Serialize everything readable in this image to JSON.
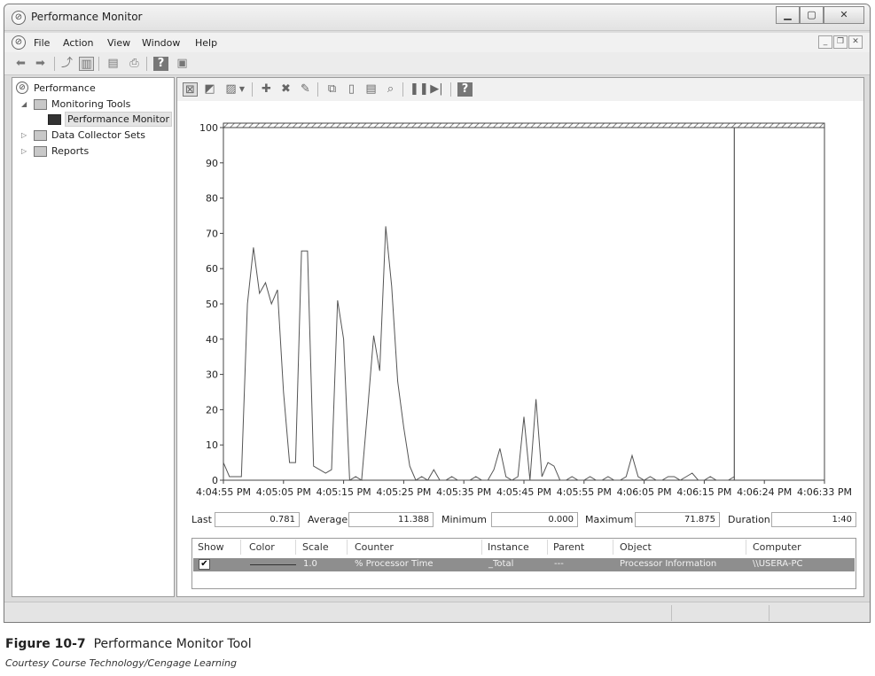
{
  "window": {
    "title": "Performance Monitor",
    "caption_buttons": [
      "minimize-icon",
      "maximize-icon",
      "close-icon"
    ]
  },
  "menu": {
    "items": [
      "File",
      "Action",
      "View",
      "Window",
      "Help"
    ]
  },
  "toolbar": {
    "icons": [
      "back-arrow-icon",
      "forward-arrow-icon",
      "up-folder-icon",
      "show-hide-tree-icon",
      "properties-icon",
      "print-icon",
      "help-icon",
      "console-icon"
    ]
  },
  "tree": {
    "root": "Performance",
    "items": [
      {
        "label": "Monitoring Tools",
        "expanded": true
      },
      {
        "label": "Performance Monitor",
        "selected": true
      },
      {
        "label": "Data Collector Sets",
        "expanded": false
      },
      {
        "label": "Reports",
        "expanded": false
      }
    ]
  },
  "perf_toolbar": {
    "icons": [
      "view-graph-icon",
      "freeze-display-icon",
      "change-graph-type-icon",
      "add-counter-icon",
      "delete-counter-icon",
      "highlight-icon",
      "copy-properties-icon",
      "paste-counter-list-icon",
      "properties-icon",
      "zoom-icon",
      "pause-icon",
      "next-frame-icon",
      "help-icon"
    ]
  },
  "chart_data": {
    "type": "line",
    "title": "",
    "xlabel": "",
    "ylabel": "",
    "ylim": [
      0,
      100
    ],
    "yticks": [
      0,
      10,
      20,
      30,
      40,
      50,
      60,
      70,
      80,
      90,
      100
    ],
    "xticks": [
      "4:04:55 PM",
      "4:05:05 PM",
      "4:05:15 PM",
      "4:05:25 PM",
      "4:05:35 PM",
      "4:05:45 PM",
      "4:05:55 PM",
      "4:06:05 PM",
      "4:06:15 PM",
      "4:06:24 PM",
      "4:06:33 PM"
    ],
    "xlim": [
      0,
      100
    ],
    "grid": false,
    "current_time_marker": 85,
    "series": [
      {
        "color": "#555555",
        "x": [
          0,
          1,
          2,
          3,
          4,
          5,
          6,
          7,
          8,
          9,
          10,
          11,
          12,
          13,
          14,
          15,
          16,
          17,
          18,
          19,
          20,
          21,
          22,
          23,
          24,
          25,
          26,
          27,
          28,
          29,
          30,
          31,
          32,
          33,
          34,
          35,
          36,
          37,
          38,
          39,
          40,
          41,
          42,
          43,
          44,
          45,
          46,
          47,
          48,
          49,
          50,
          51,
          52,
          53,
          54,
          55,
          56,
          57,
          58,
          59,
          60,
          61,
          62,
          63,
          64,
          65,
          66,
          67,
          68,
          69,
          70,
          71,
          72,
          73,
          74,
          75,
          76,
          77,
          78,
          79,
          80,
          81,
          82,
          83,
          84,
          85
        ],
        "values": [
          5,
          1,
          1,
          1,
          50,
          66,
          53,
          56,
          50,
          54,
          25,
          5,
          5,
          65,
          65,
          4,
          3,
          2,
          3,
          51,
          40,
          0,
          1,
          0,
          20,
          41,
          31,
          72,
          55,
          28,
          15,
          4,
          0,
          1,
          0,
          3,
          0,
          0,
          1,
          0,
          0,
          0,
          1,
          0,
          0,
          3,
          9,
          1,
          0,
          1,
          18,
          0,
          23,
          1,
          5,
          4,
          0,
          0,
          1,
          0,
          0,
          1,
          0,
          0,
          1,
          0,
          0,
          1,
          7,
          1,
          0,
          1,
          0,
          0,
          1,
          1,
          0,
          1,
          2,
          0,
          0,
          1,
          0,
          0,
          0,
          1
        ]
      }
    ]
  },
  "stats": {
    "last_label": "Last",
    "last_value": "0.781",
    "average_label": "Average",
    "average_value": "11.388",
    "minimum_label": "Minimum",
    "minimum_value": "0.000",
    "maximum_label": "Maximum",
    "maximum_value": "71.875",
    "duration_label": "Duration",
    "duration_value": "1:40"
  },
  "counter_table": {
    "headers": [
      "Show",
      "Color",
      "Scale",
      "Counter",
      "Instance",
      "Parent",
      "Object",
      "Computer"
    ],
    "rows": [
      {
        "show": true,
        "color": "#333333",
        "scale": "1.0",
        "counter": "% Processor Time",
        "instance": "_Total",
        "parent": "---",
        "object": "Processor Information",
        "computer": "\\\\USERA-PC"
      }
    ]
  },
  "figure": {
    "label": "Figure 10-7",
    "title": "Performance Monitor Tool",
    "credit": "Courtesy Course Technology/Cengage Learning"
  }
}
